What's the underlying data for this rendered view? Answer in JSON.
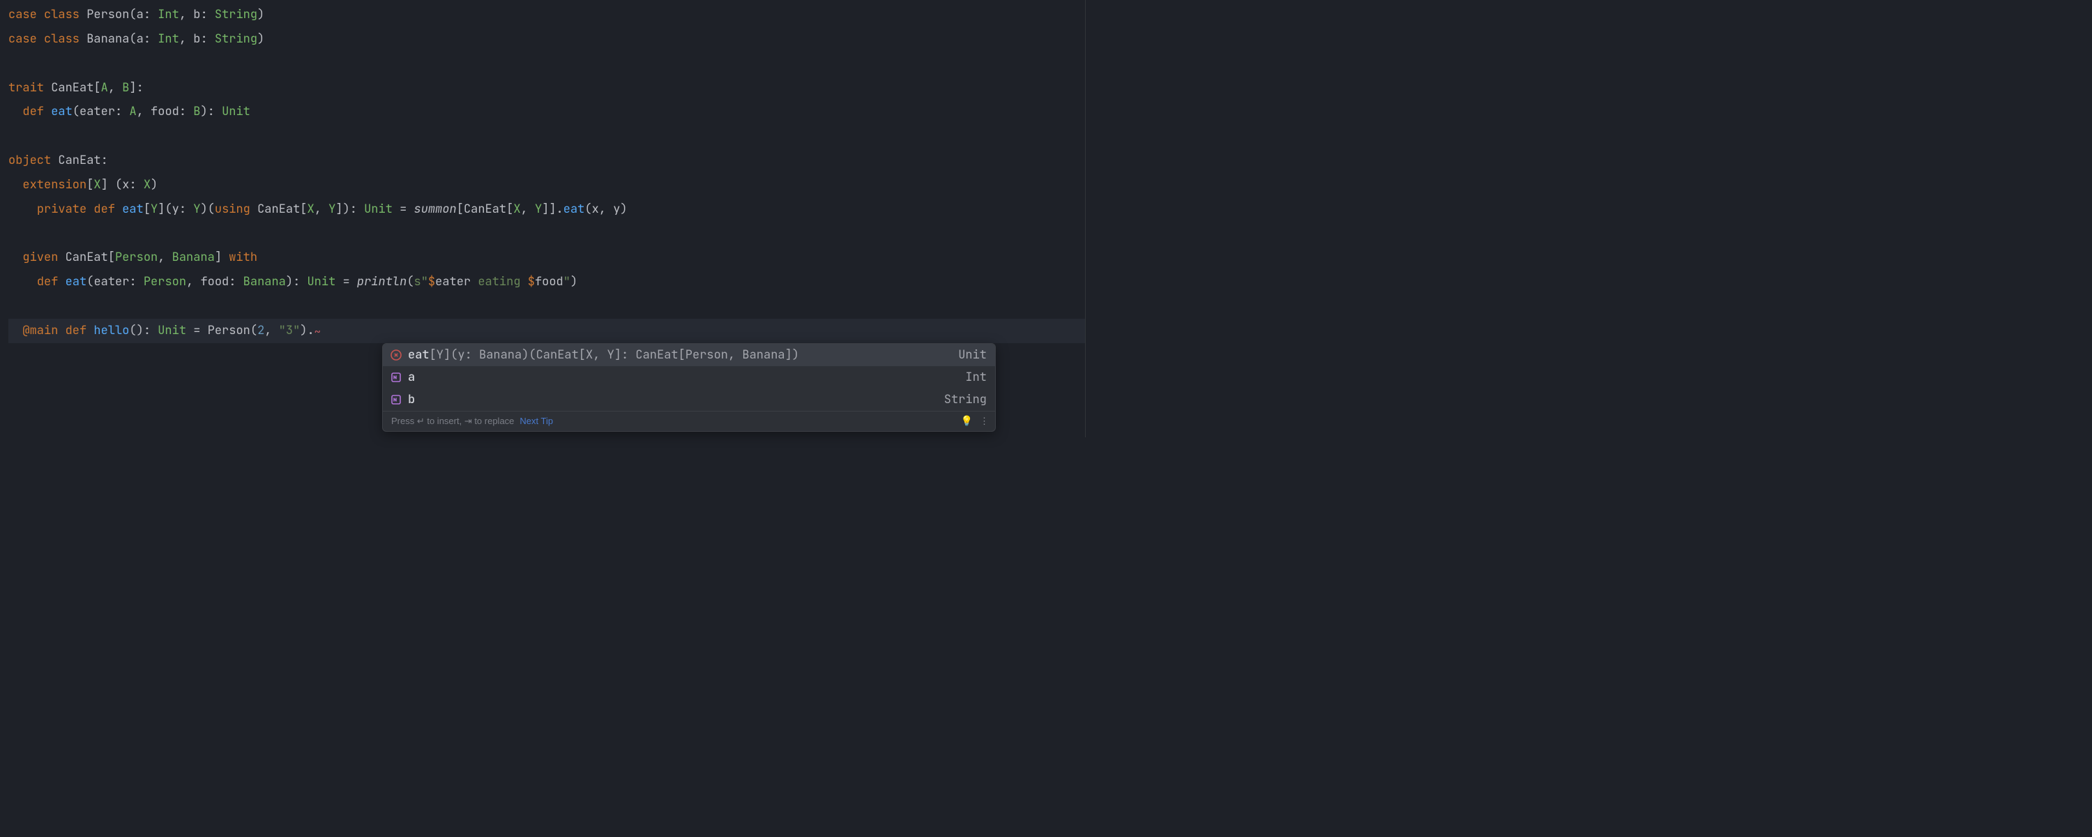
{
  "code": [
    [
      {
        "t": "case ",
        "c": "kw"
      },
      {
        "t": "class ",
        "c": "kw"
      },
      {
        "t": "Person",
        "c": "cl"
      },
      {
        "t": "(",
        "c": "pu"
      },
      {
        "t": "a",
        "c": "pn"
      },
      {
        "t": ": ",
        "c": "pu"
      },
      {
        "t": "Int",
        "c": "tp"
      },
      {
        "t": ", ",
        "c": "pu"
      },
      {
        "t": "b",
        "c": "pn"
      },
      {
        "t": ": ",
        "c": "pu"
      },
      {
        "t": "String",
        "c": "tp"
      },
      {
        "t": ")",
        "c": "pu"
      }
    ],
    [
      {
        "t": "case ",
        "c": "kw"
      },
      {
        "t": "class ",
        "c": "kw"
      },
      {
        "t": "Banana",
        "c": "cl"
      },
      {
        "t": "(",
        "c": "pu"
      },
      {
        "t": "a",
        "c": "pn"
      },
      {
        "t": ": ",
        "c": "pu"
      },
      {
        "t": "Int",
        "c": "tp"
      },
      {
        "t": ", ",
        "c": "pu"
      },
      {
        "t": "b",
        "c": "pn"
      },
      {
        "t": ": ",
        "c": "pu"
      },
      {
        "t": "String",
        "c": "tp"
      },
      {
        "t": ")",
        "c": "pu"
      }
    ],
    [],
    [
      {
        "t": "trait ",
        "c": "kw"
      },
      {
        "t": "CanEat",
        "c": "cl"
      },
      {
        "t": "[",
        "c": "pu"
      },
      {
        "t": "A",
        "c": "tp"
      },
      {
        "t": ", ",
        "c": "pu"
      },
      {
        "t": "B",
        "c": "tp"
      },
      {
        "t": "]:",
        "c": "pu"
      }
    ],
    [
      {
        "t": "  ",
        "c": "pu"
      },
      {
        "t": "def ",
        "c": "kw"
      },
      {
        "t": "eat",
        "c": "fn"
      },
      {
        "t": "(",
        "c": "pu"
      },
      {
        "t": "eater",
        "c": "pn"
      },
      {
        "t": ": ",
        "c": "pu"
      },
      {
        "t": "A",
        "c": "tp"
      },
      {
        "t": ", ",
        "c": "pu"
      },
      {
        "t": "food",
        "c": "pn"
      },
      {
        "t": ": ",
        "c": "pu"
      },
      {
        "t": "B",
        "c": "tp"
      },
      {
        "t": "): ",
        "c": "pu"
      },
      {
        "t": "Unit",
        "c": "tp"
      }
    ],
    [],
    [
      {
        "t": "object ",
        "c": "kw"
      },
      {
        "t": "CanEat",
        "c": "cl"
      },
      {
        "t": ":",
        "c": "pu"
      }
    ],
    [
      {
        "t": "  ",
        "c": "pu"
      },
      {
        "t": "extension",
        "c": "kw"
      },
      {
        "t": "[",
        "c": "pu"
      },
      {
        "t": "X",
        "c": "tp"
      },
      {
        "t": "] (",
        "c": "pu"
      },
      {
        "t": "x",
        "c": "pn"
      },
      {
        "t": ": ",
        "c": "pu"
      },
      {
        "t": "X",
        "c": "tp"
      },
      {
        "t": ")",
        "c": "pu"
      }
    ],
    [
      {
        "t": "    ",
        "c": "pu"
      },
      {
        "t": "private ",
        "c": "kw"
      },
      {
        "t": "def ",
        "c": "kw"
      },
      {
        "t": "eat",
        "c": "fn"
      },
      {
        "t": "[",
        "c": "pu"
      },
      {
        "t": "Y",
        "c": "tp"
      },
      {
        "t": "](",
        "c": "pu"
      },
      {
        "t": "y",
        "c": "pn"
      },
      {
        "t": ": ",
        "c": "pu"
      },
      {
        "t": "Y",
        "c": "tp"
      },
      {
        "t": ")(",
        "c": "pu"
      },
      {
        "t": "using ",
        "c": "kw"
      },
      {
        "t": "CanEat",
        "c": "cl"
      },
      {
        "t": "[",
        "c": "pu"
      },
      {
        "t": "X",
        "c": "tp"
      },
      {
        "t": ", ",
        "c": "pu"
      },
      {
        "t": "Y",
        "c": "tp"
      },
      {
        "t": "]): ",
        "c": "pu"
      },
      {
        "t": "Unit",
        "c": "tp"
      },
      {
        "t": " = ",
        "c": "pu"
      },
      {
        "t": "summon",
        "c": "it"
      },
      {
        "t": "[",
        "c": "pu"
      },
      {
        "t": "CanEat",
        "c": "cl"
      },
      {
        "t": "[",
        "c": "pu"
      },
      {
        "t": "X",
        "c": "tp"
      },
      {
        "t": ", ",
        "c": "pu"
      },
      {
        "t": "Y",
        "c": "tp"
      },
      {
        "t": "]].",
        "c": "pu"
      },
      {
        "t": "eat",
        "c": "fn"
      },
      {
        "t": "(",
        "c": "pu"
      },
      {
        "t": "x",
        "c": "pn"
      },
      {
        "t": ", ",
        "c": "pu"
      },
      {
        "t": "y",
        "c": "pn"
      },
      {
        "t": ")",
        "c": "pu"
      }
    ],
    [],
    [
      {
        "t": "  ",
        "c": "pu"
      },
      {
        "t": "given ",
        "c": "kw"
      },
      {
        "t": "CanEat",
        "c": "cl"
      },
      {
        "t": "[",
        "c": "pu"
      },
      {
        "t": "Person",
        "c": "tp"
      },
      {
        "t": ", ",
        "c": "pu"
      },
      {
        "t": "Banana",
        "c": "tp"
      },
      {
        "t": "] ",
        "c": "pu"
      },
      {
        "t": "with",
        "c": "kw"
      }
    ],
    [
      {
        "t": "    ",
        "c": "pu"
      },
      {
        "t": "def ",
        "c": "kw"
      },
      {
        "t": "eat",
        "c": "fn"
      },
      {
        "t": "(",
        "c": "pu"
      },
      {
        "t": "eater",
        "c": "pn"
      },
      {
        "t": ": ",
        "c": "pu"
      },
      {
        "t": "Person",
        "c": "tp"
      },
      {
        "t": ", ",
        "c": "pu"
      },
      {
        "t": "food",
        "c": "pn"
      },
      {
        "t": ": ",
        "c": "pu"
      },
      {
        "t": "Banana",
        "c": "tp"
      },
      {
        "t": "): ",
        "c": "pu"
      },
      {
        "t": "Unit",
        "c": "tp"
      },
      {
        "t": " = ",
        "c": "pu"
      },
      {
        "t": "println",
        "c": "it"
      },
      {
        "t": "(",
        "c": "pu"
      },
      {
        "t": "s",
        "c": "intp"
      },
      {
        "t": "\"",
        "c": "st"
      },
      {
        "t": "$",
        "c": "dol"
      },
      {
        "t": "eater",
        "c": "pn"
      },
      {
        "t": " eating ",
        "c": "st"
      },
      {
        "t": "$",
        "c": "dol"
      },
      {
        "t": "food",
        "c": "pn"
      },
      {
        "t": "\"",
        "c": "st"
      },
      {
        "t": ")",
        "c": "pu"
      }
    ],
    [],
    [
      {
        "t": "  ",
        "c": "pu"
      },
      {
        "t": "@main ",
        "c": "kw"
      },
      {
        "t": "def ",
        "c": "kw"
      },
      {
        "t": "hello",
        "c": "fn"
      },
      {
        "t": "(): ",
        "c": "pu"
      },
      {
        "t": "Unit",
        "c": "tp"
      },
      {
        "t": " = ",
        "c": "pu"
      },
      {
        "t": "Person",
        "c": "cl"
      },
      {
        "t": "(",
        "c": "pu"
      },
      {
        "t": "2",
        "c": "nu"
      },
      {
        "t": ", ",
        "c": "pu"
      },
      {
        "t": "\"3\"",
        "c": "st"
      },
      {
        "t": ").",
        "c": "pu"
      },
      {
        "t": "~",
        "c": "squiggle"
      }
    ]
  ],
  "current_line_index": 13,
  "popup": {
    "items": [
      {
        "icon": "method-private",
        "main_hl": "eat",
        "main_rest": "[Y](y: Banana)(CanEat[X, Y]: CanEat[Person, Banana])",
        "tail": "Unit",
        "selected": true
      },
      {
        "icon": "field",
        "main_hl": "a",
        "main_rest": "",
        "tail": "Int",
        "selected": false
      },
      {
        "icon": "field",
        "main_hl": "b",
        "main_rest": "",
        "tail": "String",
        "selected": false
      }
    ],
    "footer_hint": "Press ↵ to insert, ⇥ to replace",
    "footer_link": "Next Tip",
    "footer_kebab": "⋮"
  },
  "colors": {
    "error_icon": "#c75450",
    "field_icon": "#b174d8"
  }
}
